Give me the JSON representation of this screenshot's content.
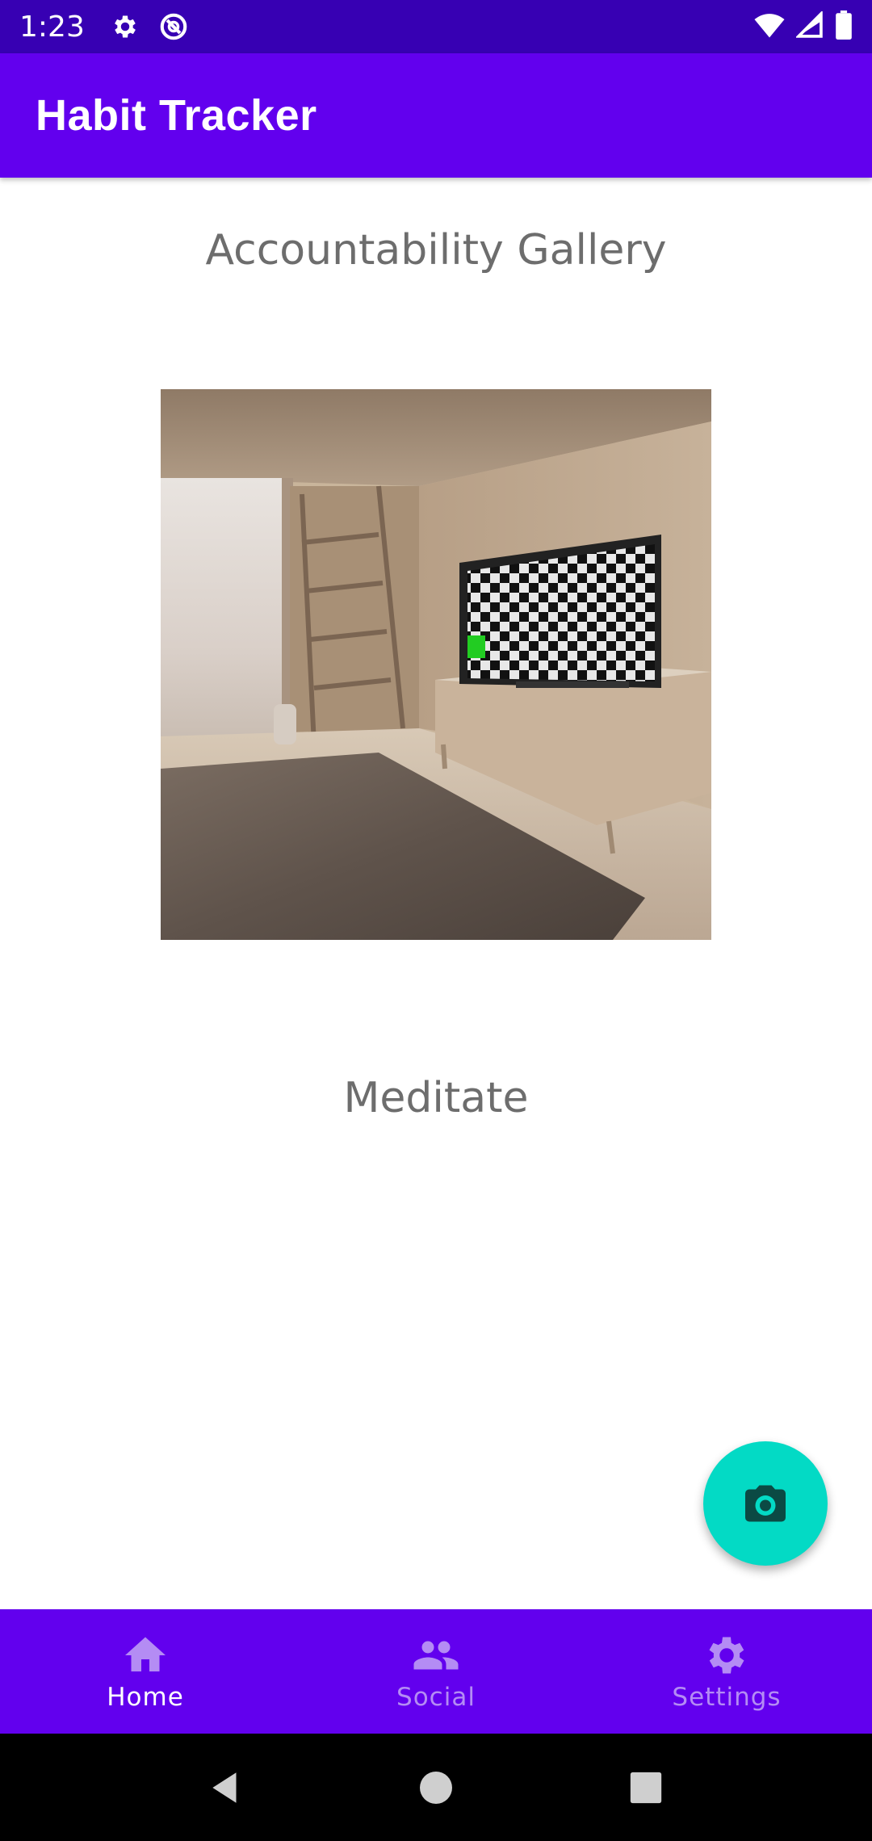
{
  "status_bar": {
    "time": "1:23",
    "icons": [
      "settings-icon",
      "do-not-disturb-icon",
      "wifi-icon",
      "signal-icon",
      "battery-icon"
    ]
  },
  "app_bar": {
    "title": "Habit Tracker"
  },
  "main": {
    "gallery_title": "Accountability Gallery",
    "habit_name": "Meditate"
  },
  "fab": {
    "icon": "camera-icon",
    "color": "#03dac5"
  },
  "bottom_nav": {
    "items": [
      {
        "label": "Home",
        "icon": "home-icon",
        "active": true
      },
      {
        "label": "Social",
        "icon": "people-icon",
        "active": false
      },
      {
        "label": "Settings",
        "icon": "gear-icon",
        "active": false
      }
    ]
  },
  "colors": {
    "primary": "#6200ee",
    "primary_dark": "#3700b3",
    "accent": "#03dac5"
  }
}
